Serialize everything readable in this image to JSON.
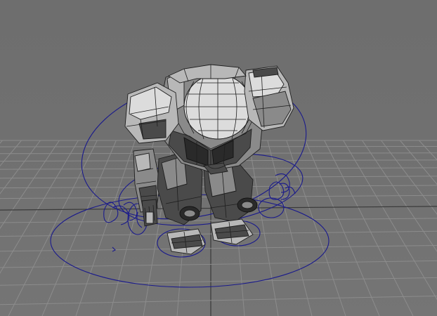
{
  "viewport": {
    "background": "#707070",
    "grid_color": "#8c8c8c",
    "axis_color": "#3a3a3a",
    "control_curve_color": "#1a1a8c"
  },
  "scene": {
    "grid": {
      "visible": true
    },
    "model": {
      "kind": "mech-robot",
      "display": "wireframe-on-shaded"
    },
    "rig_controls": {
      "visible": true
    }
  }
}
